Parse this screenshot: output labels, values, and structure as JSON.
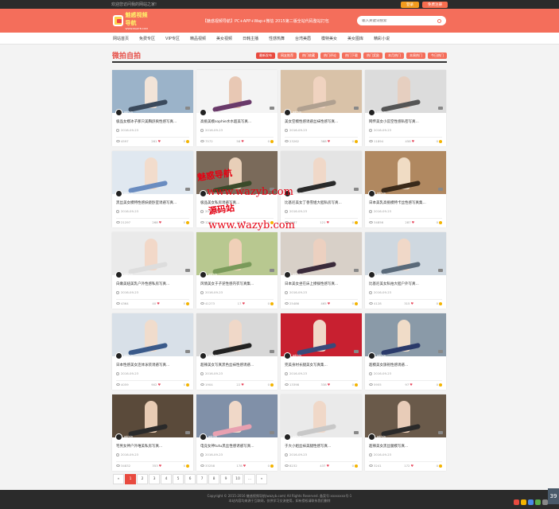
{
  "topbar": {
    "welcome": "欢迎您访问我的网站之家!",
    "login": "登录",
    "register": "免费注册"
  },
  "logo": {
    "main": "魅惑视频导航",
    "sub": "WWW.WAZYB.COM"
  },
  "header": {
    "slogan": "【魅惑视频导航】PC+APP+Wap+微信 2015第二版全站代码整站打包",
    "search_placeholder": "输入关键词搜索"
  },
  "nav": [
    "网站首页",
    "免费专区",
    "VIP专区",
    "精品视频",
    "美女视频",
    "日韩主播",
    "性感热舞",
    "台湾美眉",
    "模特美女",
    "美女图库",
    "精彩小说"
  ],
  "section": {
    "title": "微拍自拍",
    "tags": [
      "最新发布",
      "网友推荐",
      "热门收藏",
      "热门评论",
      "热门下载",
      "热门奖励",
      "本月热门",
      "本周热门",
      "今日热门"
    ]
  },
  "cards": [
    {
      "title": "极品女模冰子那只美胸舒爽性感写真...",
      "date": "2016-09-23",
      "views": "4597",
      "likes": "261",
      "coins": "0",
      "author": "admin"
    },
    {
      "title": "高挑美模sophie水水超美写真...",
      "date": "2016-09-23",
      "views": "7572",
      "likes": "58",
      "coins": "0",
      "author": "admin"
    },
    {
      "title": "美女空模性感诱惑丝袜性感写真...",
      "date": "2016-09-23",
      "views": "23262",
      "likes": "368",
      "coins": "0",
      "author": "admin"
    },
    {
      "title": "网传美女小蕊空性感私密写真...",
      "date": "2016-09-23",
      "views": "11894",
      "likes": "458",
      "coins": "0",
      "author": "admin"
    },
    {
      "title": "黑丝美女模特性感妖娆卧室诱惑写真...",
      "date": "2016-09-23",
      "views": "21297",
      "likes": "268",
      "coins": "0",
      "author": "admin"
    },
    {
      "title": "极品美女私房诱惑写真...",
      "date": "2016-09-23",
      "views": "12654",
      "likes": "321",
      "coins": "0",
      "author": "admin"
    },
    {
      "title": "比基尼美女丁香雪姐大胆私房写真...",
      "date": "2016-09-23",
      "views": "4987",
      "likes": "121",
      "coins": "0",
      "author": "admin"
    },
    {
      "title": "日本美乳高挑模特卡丝性感写真集...",
      "date": "2016-09-23",
      "views": "34856",
      "likes": "287",
      "coins": "0",
      "author": "admin"
    },
    {
      "title": "白嫩美妞美乳户外性感私房写真...",
      "date": "2016-09-23",
      "views": "4364",
      "likes": "40",
      "coins": "0",
      "author": "admin"
    },
    {
      "title": "风情美女于子逆性感内衣写真集...",
      "date": "2016-09-23",
      "views": "41273",
      "likes": "17",
      "coins": "0",
      "author": "admin"
    },
    {
      "title": "日本美女坐在床上撩拨性感写真...",
      "date": "2016-09-23",
      "views": "25486",
      "likes": "465",
      "coins": "0",
      "author": "admin"
    },
    {
      "title": "比基尼美女私拍大胆户外写真...",
      "date": "2016-09-23",
      "views": "4128",
      "likes": "315",
      "coins": "0",
      "author": "admin"
    },
    {
      "title": "日本性感美女连体泳装诱惑写真...",
      "date": "2016-09-23",
      "views": "4059",
      "likes": "902",
      "coins": "0",
      "author": "admin"
    },
    {
      "title": "超辣美女写真黑色丝袜性感诱惑...",
      "date": "2016-09-23",
      "views": "1904",
      "likes": "22",
      "coins": "0",
      "author": "admin"
    },
    {
      "title": "完美身材长腿美女写真集...",
      "date": "2016-09-23",
      "views": "13398",
      "likes": "338",
      "coins": "0",
      "author": "admin"
    },
    {
      "title": "超模美女旗袍性感诱惑...",
      "date": "2016-09-23",
      "views": "5955",
      "likes": "97",
      "coins": "0",
      "author": "admin"
    },
    {
      "title": "宅男女神户外唯美私房写真...",
      "date": "2016-09-23",
      "views": "34832",
      "likes": "353",
      "coins": "0",
      "author": "admin"
    },
    {
      "title": "电竞女神tutu黑丝性感诱惑写真...",
      "date": "2016-09-23",
      "views": "33258",
      "likes": "178",
      "coins": "0",
      "author": "admin"
    },
    {
      "title": "于大小姐丝袜美腿性感写真...",
      "date": "2016-09-23",
      "views": "8232",
      "likes": "437",
      "coins": "0",
      "author": "admin"
    },
    {
      "title": "超辣美女黑丝腿模写真...",
      "date": "2016-09-23",
      "views": "3241",
      "likes": "172",
      "coins": "0",
      "author": "admin"
    }
  ],
  "thumb_colors": [
    [
      "#9bb3c9",
      "#f2e4d8",
      "#3b4a5c"
    ],
    [
      "#f4f4f4",
      "#e8c8b4",
      "#6a3a6a"
    ],
    [
      "#d9c2a8",
      "#f0d3c0",
      "#b0a090"
    ],
    [
      "#dcdcdc",
      "#e6cfc0",
      "#555"
    ],
    [
      "#e0e8f0",
      "#f2dccc",
      "#6a8cc0"
    ],
    [
      "#7a6a5a",
      "#e8cfb8",
      "#3a4a2a"
    ],
    [
      "#e4e4e4",
      "#f0d8c8",
      "#2a2a2a"
    ],
    [
      "#b08860",
      "#f0dcc4",
      "#3a2a1a"
    ],
    [
      "#eaeaea",
      "#f2d8c8",
      "#dddddd"
    ],
    [
      "#b8c890",
      "#f0d0b8",
      "#7a9a5a"
    ],
    [
      "#d8d0c8",
      "#ecd0c0",
      "#3a2a3a"
    ],
    [
      "#cfd8e0",
      "#f0d8c8",
      "#5a6a7a"
    ],
    [
      "#d8e0e8",
      "#f0dccc",
      "#3a5a8a"
    ],
    [
      "#d8d8d8",
      "#f0d8c8",
      "#222"
    ],
    [
      "#c82030",
      "#f0d8c8",
      "#3a4a7a"
    ],
    [
      "#8a9aa8",
      "#f0dcc8",
      "#2a3a6a"
    ],
    [
      "#5a4a3a",
      "#e8ccb4",
      "#2a2a2a"
    ],
    [
      "#8090a8",
      "#f0d8c8",
      "#e8a0b0"
    ],
    [
      "#eaeaea",
      "#f0d8c8",
      "#c8c8c8"
    ],
    [
      "#6a5a4a",
      "#e8ccb8",
      "#2a2a2a"
    ]
  ],
  "pager": [
    "«",
    "1",
    "2",
    "3",
    "4",
    "5",
    "6",
    "7",
    "8",
    "9",
    "10",
    "...",
    "»"
  ],
  "pager_current": "1",
  "footer": {
    "line1": "Copyright © 2015-2016 魅惑视频导航(wazyb.com) All Rights Reserved. 备案号:xxxxxxxx号-1",
    "line2": "本站内容均来源于互联网，仅供学习交流使用，如有侵权请联系我们删除"
  },
  "watermark": {
    "text1": "www.wazyb.com",
    "text2": "www.wazyb.com",
    "seal1": "魅惑导航",
    "seal2": "源码站"
  },
  "tray": {
    "number": "39"
  },
  "colors": {
    "brand": "#f46e5b",
    "accent": "#e84a3f",
    "topbar": "#2b2b2b"
  }
}
